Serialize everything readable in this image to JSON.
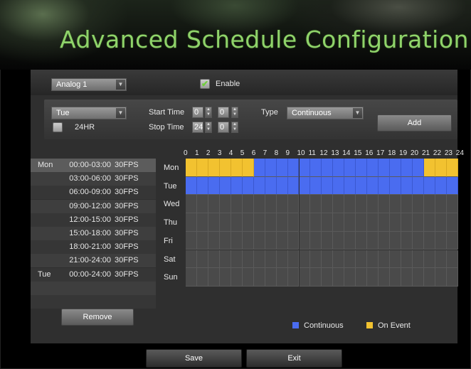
{
  "title": "Advanced Schedule Configuration",
  "camera": {
    "selected": "Analog 1"
  },
  "enable": {
    "label": "Enable",
    "checked": true
  },
  "day_select": {
    "selected": "Tue"
  },
  "hr24": {
    "label": "24HR",
    "checked": false
  },
  "start_time": {
    "label": "Start Time",
    "hour": "0",
    "minute": "0"
  },
  "stop_time": {
    "label": "Stop Time",
    "hour": "24",
    "minute": "0"
  },
  "type": {
    "label": "Type",
    "selected": "Continuous"
  },
  "add_label": "Add",
  "schedule_list": [
    {
      "day": "Mon",
      "range": "00:00-03:00",
      "fps": "30FPS"
    },
    {
      "day": "",
      "range": "03:00-06:00",
      "fps": "30FPS"
    },
    {
      "day": "",
      "range": "06:00-09:00",
      "fps": "30FPS"
    },
    {
      "day": "",
      "range": "09:00-12:00",
      "fps": "30FPS"
    },
    {
      "day": "",
      "range": "12:00-15:00",
      "fps": "30FPS"
    },
    {
      "day": "",
      "range": "15:00-18:00",
      "fps": "30FPS"
    },
    {
      "day": "",
      "range": "18:00-21:00",
      "fps": "30FPS"
    },
    {
      "day": "",
      "range": "21:00-24:00",
      "fps": "30FPS"
    },
    {
      "day": "Tue",
      "range": "00:00-24:00",
      "fps": "30FPS"
    }
  ],
  "hours": [
    "0",
    "1",
    "2",
    "3",
    "4",
    "5",
    "6",
    "7",
    "8",
    "9",
    "10",
    "11",
    "12",
    "13",
    "14",
    "15",
    "16",
    "17",
    "18",
    "19",
    "20",
    "21",
    "22",
    "23",
    "24"
  ],
  "days": [
    "Mon",
    "Tue",
    "Wed",
    "Thu",
    "Fri",
    "Sat",
    "Sun"
  ],
  "schedule_grid": {
    "Mon": [
      "E",
      "E",
      "E",
      "E",
      "E",
      "E",
      "C",
      "C",
      "C",
      "C",
      "C",
      "C",
      "C",
      "C",
      "C",
      "C",
      "C",
      "C",
      "C",
      "C",
      "C",
      "E",
      "E",
      "E"
    ],
    "Tue": [
      "C",
      "C",
      "C",
      "C",
      "C",
      "C",
      "C",
      "C",
      "C",
      "C",
      "C",
      "C",
      "C",
      "C",
      "C",
      "C",
      "C",
      "C",
      "C",
      "C",
      "C",
      "C",
      "C",
      "C"
    ],
    "Wed": [],
    "Thu": [],
    "Fri": [],
    "Sat": [],
    "Sun": []
  },
  "colors": {
    "continuous": "#4a6cf0",
    "on_event": "#f2c230",
    "empty": "#4a4a4a",
    "accent": "#8fd36a"
  },
  "legend": {
    "continuous": "Continuous",
    "on_event": "On Event"
  },
  "remove_label": "Remove",
  "save_label": "Save",
  "exit_label": "Exit"
}
